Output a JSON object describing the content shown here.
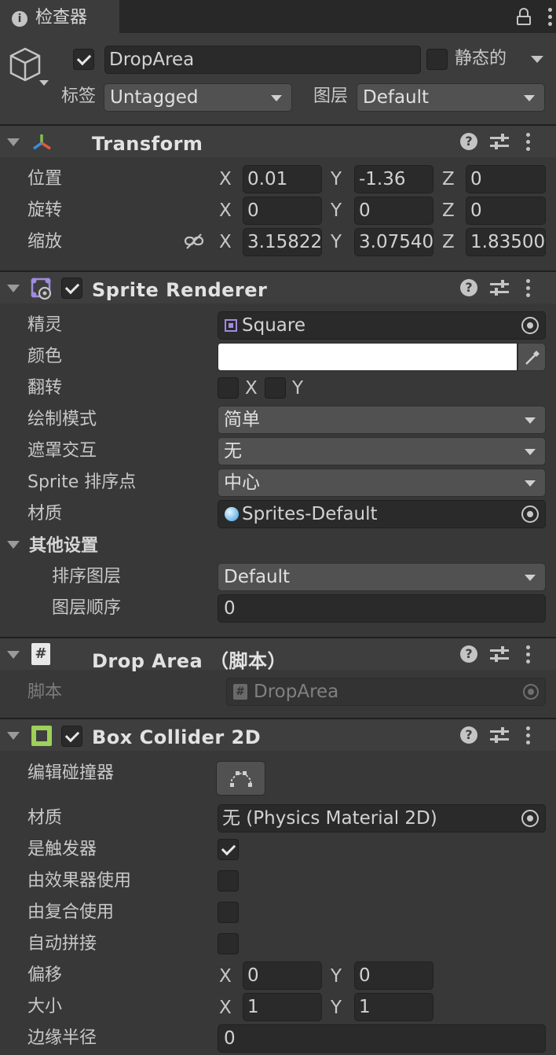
{
  "tab": {
    "title": "检查器"
  },
  "object": {
    "name": "DropArea",
    "active": true,
    "static_label": "静态的",
    "tag_label": "标签",
    "tag_value": "Untagged",
    "layer_label": "图层",
    "layer_value": "Default"
  },
  "transform": {
    "title": "Transform",
    "position_label": "位置",
    "rotation_label": "旋转",
    "scale_label": "缩放",
    "x": "X",
    "y": "Y",
    "z": "Z",
    "position": {
      "x": "0.01",
      "y": "-1.36",
      "z": "0"
    },
    "rotation": {
      "x": "0",
      "y": "0",
      "z": "0"
    },
    "scale": {
      "x": "3.15822",
      "y": "3.07540",
      "z": "1.83500"
    }
  },
  "sprite_renderer": {
    "title": "Sprite Renderer",
    "enabled": true,
    "sprite_label": "精灵",
    "sprite_value": "Square",
    "color_label": "颜色",
    "color_value": "#ffffff",
    "flip_label": "翻转",
    "flip_x": "X",
    "flip_y": "Y",
    "draw_mode_label": "绘制模式",
    "draw_mode_value": "简单",
    "mask_label": "遮罩交互",
    "mask_value": "无",
    "sort_point_label": "Sprite 排序点",
    "sort_point_value": "中心",
    "material_label": "材质",
    "material_value": "Sprites-Default",
    "other_settings_label": "其他设置",
    "sorting_layer_label": "排序图层",
    "sorting_layer_value": "Default",
    "order_label": "图层顺序",
    "order_value": "0"
  },
  "drop_area": {
    "title": "Drop Area （脚本）",
    "script_label": "脚本",
    "script_value": "DropArea"
  },
  "box_collider": {
    "title": "Box Collider 2D",
    "enabled": true,
    "edit_label": "编辑碰撞器",
    "material_label": "材质",
    "material_value": "无 (Physics Material 2D)",
    "trigger_label": "是触发器",
    "trigger": true,
    "effector_label": "由效果器使用",
    "effector": false,
    "composite_label": "由复合使用",
    "composite": false,
    "autotile_label": "自动拼接",
    "autotile": false,
    "offset_label": "偏移",
    "offset": {
      "x": "0",
      "y": "0"
    },
    "size_label": "大小",
    "size": {
      "x": "1",
      "y": "1"
    },
    "edge_label": "边缘半径",
    "edge_value": "0",
    "x": "X",
    "y": "Y"
  }
}
